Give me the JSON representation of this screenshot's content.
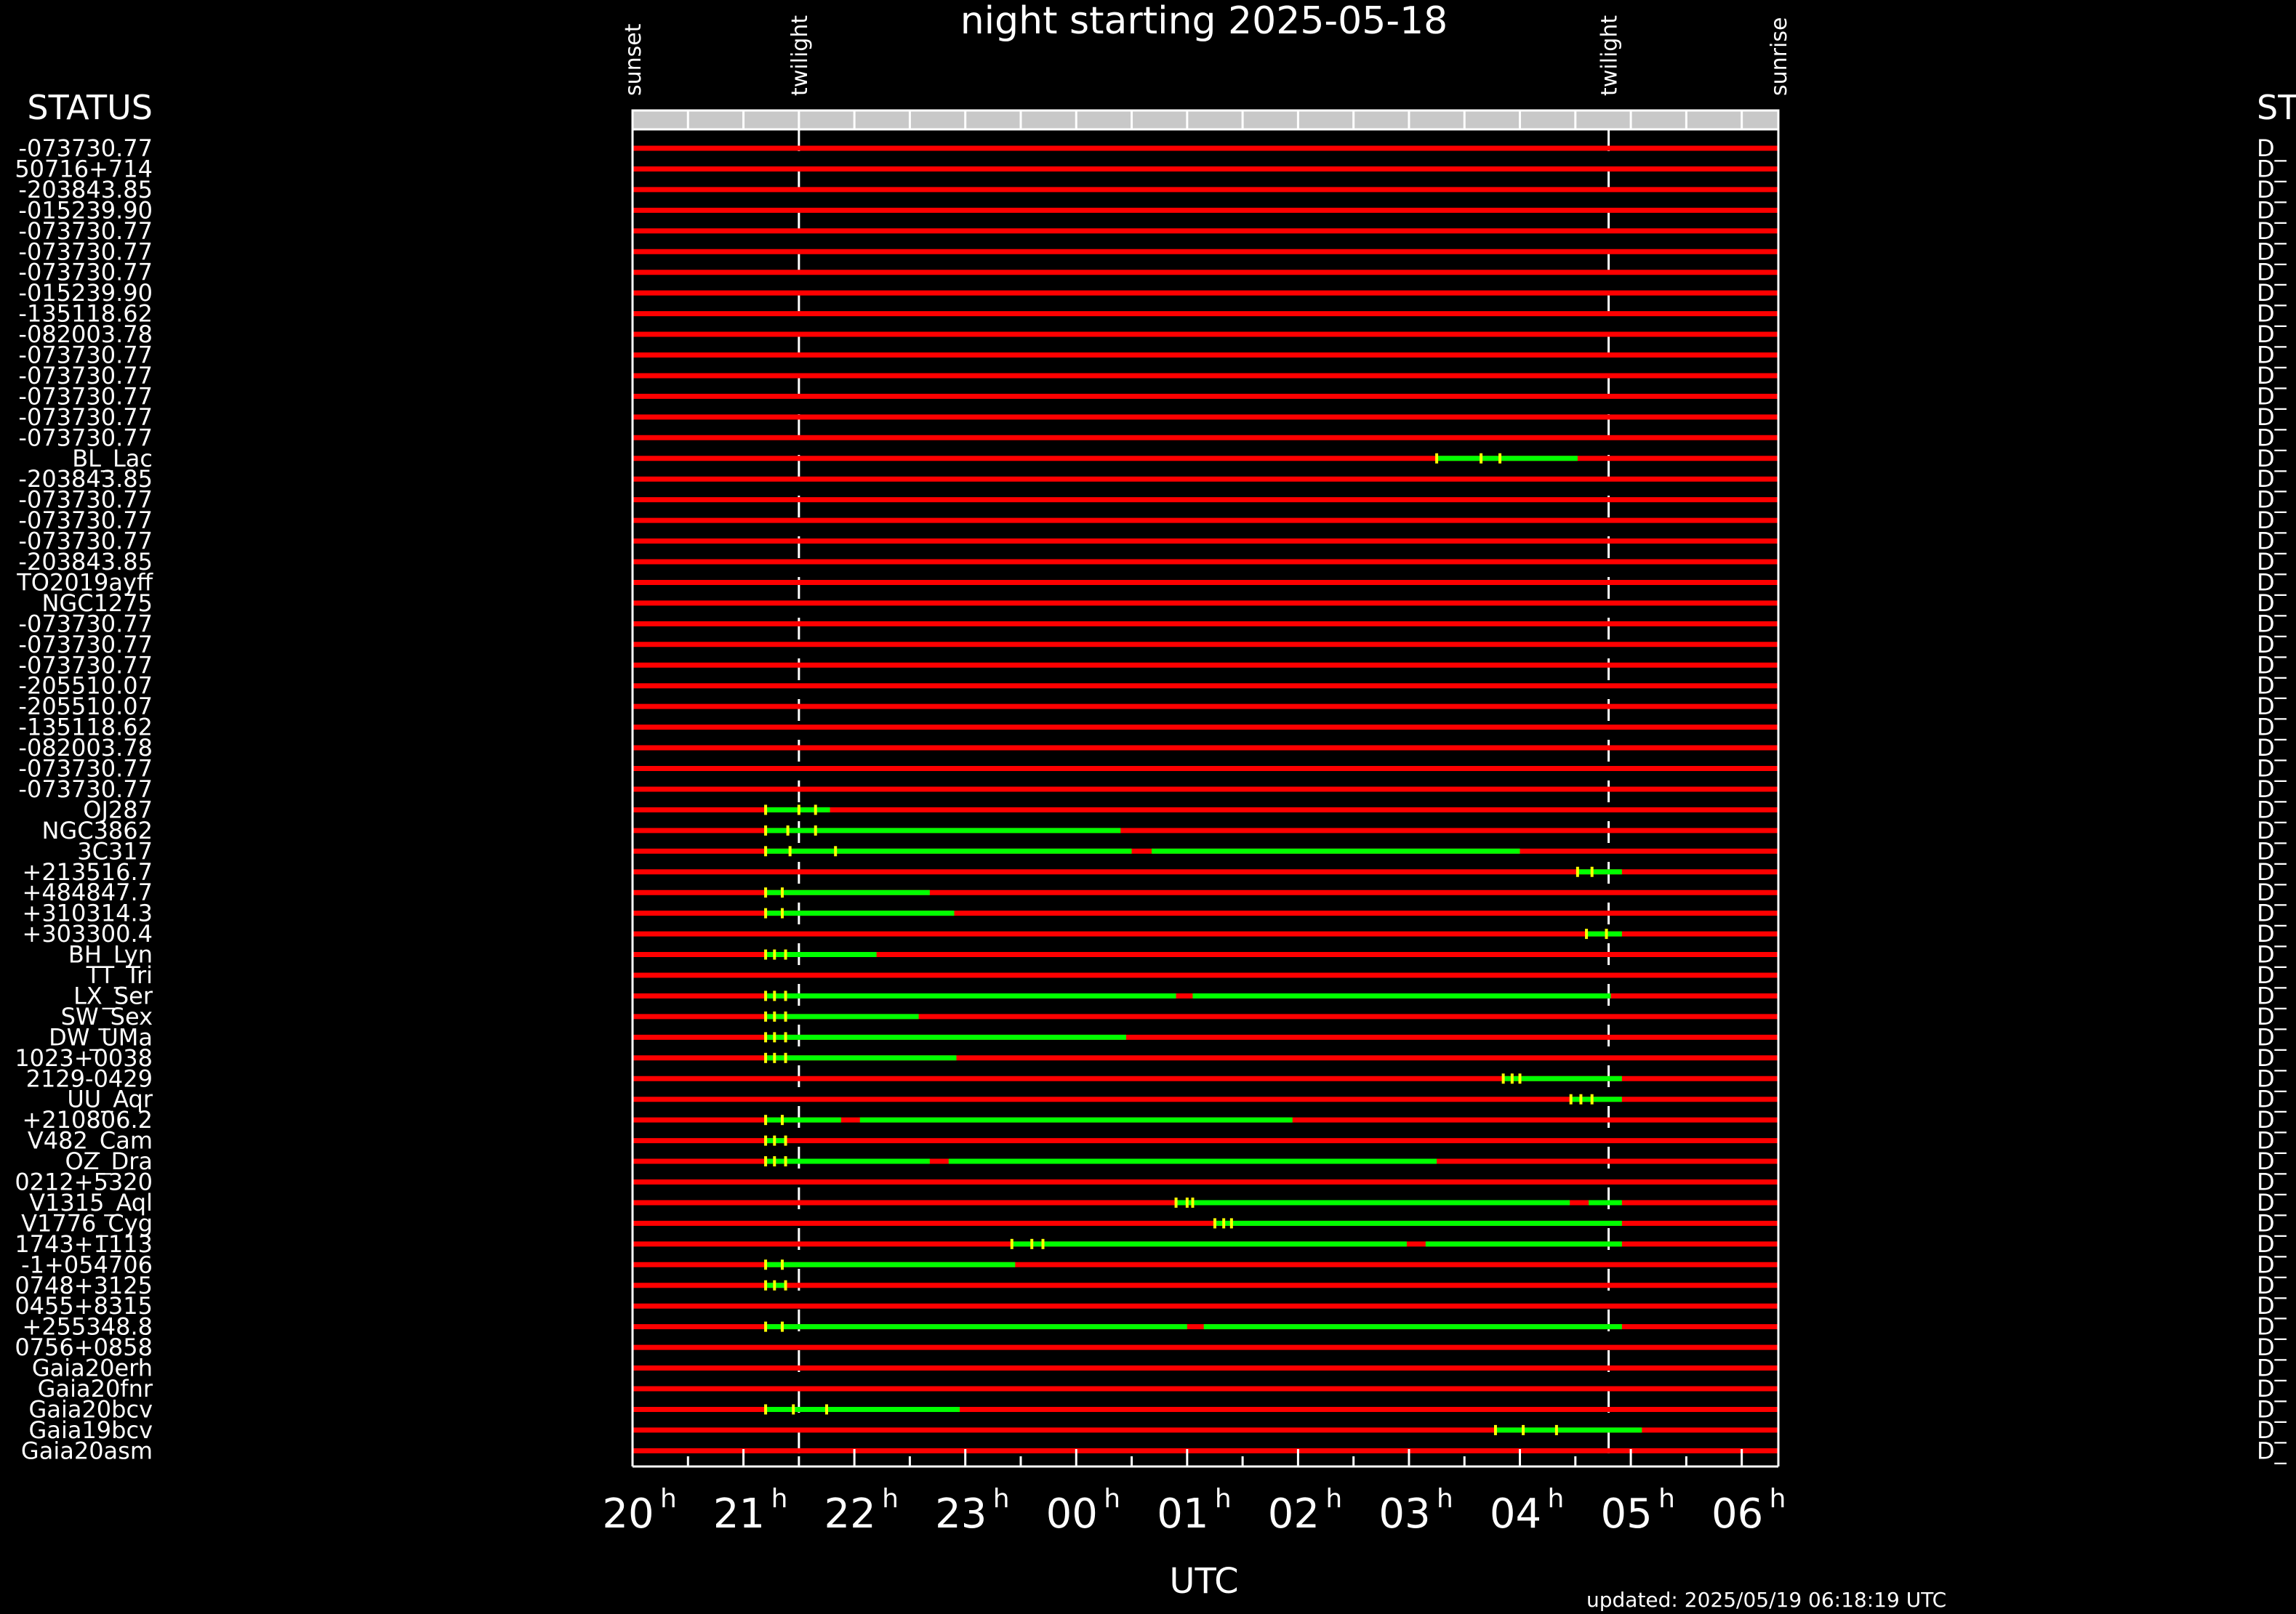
{
  "title": "night starting 2025-05-18",
  "status_header": "STATUS",
  "right_header": "ST",
  "xlabel": "UTC",
  "updated": "updated: 2025/05/19 06:18:19 UTC",
  "colors": {
    "background": "#000000",
    "unobservable": "#ff0000",
    "observable": "#00ff00",
    "marker": "#ffff00",
    "text": "#ffffff"
  },
  "chart_data": {
    "type": "timeline",
    "x_unit": "hours UTC (night starting 2025-05-18, values >24 are after midnight)",
    "xlim": [
      20.0,
      30.33
    ],
    "ticks": [
      {
        "label": "20",
        "value": 20
      },
      {
        "label": "21",
        "value": 21
      },
      {
        "label": "22",
        "value": 22
      },
      {
        "label": "23",
        "value": 23
      },
      {
        "label": "00",
        "value": 24
      },
      {
        "label": "01",
        "value": 25
      },
      {
        "label": "02",
        "value": 26
      },
      {
        "label": "03",
        "value": 27
      },
      {
        "label": "04",
        "value": 28
      },
      {
        "label": "05",
        "value": 29
      },
      {
        "label": "06",
        "value": 30
      }
    ],
    "tick_suffix": "h",
    "events": [
      {
        "label": "sunset",
        "value": 20.0,
        "dashed": false
      },
      {
        "label": "twilight",
        "value": 21.5,
        "dashed": true
      },
      {
        "label": "twilight",
        "value": 28.8,
        "dashed": true
      },
      {
        "label": "sunrise",
        "value": 30.33,
        "dashed": false
      }
    ],
    "rows": [
      {
        "name": "-073730.77",
        "status": "D_",
        "segs": []
      },
      {
        "name": "50716+714",
        "status": "D_",
        "segs": []
      },
      {
        "name": "-203843.85",
        "status": "D_",
        "segs": []
      },
      {
        "name": "-015239.90",
        "status": "D_",
        "segs": []
      },
      {
        "name": "-073730.77",
        "status": "D_",
        "segs": []
      },
      {
        "name": "-073730.77",
        "status": "D_",
        "segs": []
      },
      {
        "name": "-073730.77",
        "status": "D_",
        "segs": []
      },
      {
        "name": "-015239.90",
        "status": "D_",
        "segs": []
      },
      {
        "name": "-135118.62",
        "status": "D_",
        "segs": []
      },
      {
        "name": "-082003.78",
        "status": "D_",
        "segs": []
      },
      {
        "name": "-073730.77",
        "status": "D_",
        "segs": []
      },
      {
        "name": "-073730.77",
        "status": "D_",
        "segs": []
      },
      {
        "name": "-073730.77",
        "status": "D_",
        "segs": []
      },
      {
        "name": "-073730.77",
        "status": "D_",
        "segs": []
      },
      {
        "name": "-073730.77",
        "status": "D_",
        "segs": []
      },
      {
        "name": "BL_Lac",
        "status": "D_",
        "segs": [
          [
            27.25,
            28.52
          ]
        ],
        "marks": [
          27.25,
          27.65,
          27.82
        ]
      },
      {
        "name": "-203843.85",
        "status": "D_",
        "segs": []
      },
      {
        "name": "-073730.77",
        "status": "D_",
        "segs": []
      },
      {
        "name": "-073730.77",
        "status": "D_",
        "segs": []
      },
      {
        "name": "-073730.77",
        "status": "D_",
        "segs": []
      },
      {
        "name": "-203843.85",
        "status": "D_",
        "segs": []
      },
      {
        "name": "TO2019ayff",
        "status": "D_",
        "segs": []
      },
      {
        "name": "NGC1275",
        "status": "D_",
        "segs": []
      },
      {
        "name": "-073730.77",
        "status": "D_",
        "segs": []
      },
      {
        "name": "-073730.77",
        "status": "D_",
        "segs": []
      },
      {
        "name": "-073730.77",
        "status": "D_",
        "segs": []
      },
      {
        "name": "-205510.07",
        "status": "D_",
        "segs": []
      },
      {
        "name": "-205510.07",
        "status": "D_",
        "segs": []
      },
      {
        "name": "-135118.62",
        "status": "D_",
        "segs": []
      },
      {
        "name": "-082003.78",
        "status": "D_",
        "segs": []
      },
      {
        "name": "-073730.77",
        "status": "D_",
        "segs": []
      },
      {
        "name": "-073730.77",
        "status": "D_",
        "segs": []
      },
      {
        "name": "OJ287",
        "status": "D_",
        "segs": [
          [
            21.2,
            21.78
          ]
        ],
        "marks": [
          21.2,
          21.5,
          21.65
        ]
      },
      {
        "name": "NGC3862",
        "status": "D_",
        "segs": [
          [
            21.2,
            24.4
          ]
        ],
        "marks": [
          21.2,
          21.4,
          21.65
        ]
      },
      {
        "name": "3C317",
        "status": "D_",
        "segs": [
          [
            21.2,
            24.5
          ],
          [
            24.68,
            28.0
          ]
        ],
        "marks": [
          21.2,
          21.42,
          21.83
        ]
      },
      {
        "name": "+213516.7",
        "status": "D_",
        "segs": [
          [
            28.52,
            28.92
          ]
        ],
        "marks": [
          28.52,
          28.65
        ]
      },
      {
        "name": "+484847.7",
        "status": "D_",
        "segs": [
          [
            21.2,
            22.68
          ]
        ],
        "marks": [
          21.2,
          21.35
        ]
      },
      {
        "name": "+310314.3",
        "status": "D_",
        "segs": [
          [
            21.2,
            22.9
          ]
        ],
        "marks": [
          21.2,
          21.35
        ]
      },
      {
        "name": "+303300.4",
        "status": "D_",
        "segs": [
          [
            28.6,
            28.92
          ]
        ],
        "marks": [
          28.6,
          28.78
        ]
      },
      {
        "name": "BH_Lyn",
        "status": "D_",
        "segs": [
          [
            21.2,
            22.2
          ]
        ],
        "marks": [
          21.2,
          21.28,
          21.38
        ]
      },
      {
        "name": "TT_Tri",
        "status": "D_",
        "segs": []
      },
      {
        "name": "LX_Ser",
        "status": "D_",
        "segs": [
          [
            21.2,
            24.9
          ],
          [
            25.05,
            28.82
          ]
        ],
        "marks": [
          21.2,
          21.28,
          21.38
        ]
      },
      {
        "name": "SW_Sex",
        "status": "D_",
        "segs": [
          [
            21.2,
            22.58
          ]
        ],
        "marks": [
          21.2,
          21.28,
          21.38
        ]
      },
      {
        "name": "DW_UMa",
        "status": "D_",
        "segs": [
          [
            21.2,
            24.45
          ]
        ],
        "marks": [
          21.2,
          21.28,
          21.38
        ]
      },
      {
        "name": "1023+0038",
        "status": "D_",
        "segs": [
          [
            21.2,
            22.92
          ]
        ],
        "marks": [
          21.2,
          21.28,
          21.38
        ]
      },
      {
        "name": "2129-0429",
        "status": "D_",
        "segs": [
          [
            27.85,
            28.92
          ]
        ],
        "marks": [
          27.85,
          27.93,
          28.0
        ]
      },
      {
        "name": "UU_Aqr",
        "status": "D_",
        "segs": [
          [
            28.46,
            28.92
          ]
        ],
        "marks": [
          28.46,
          28.55,
          28.65
        ]
      },
      {
        "name": "+210806.2",
        "status": "D_",
        "segs": [
          [
            21.2,
            21.88
          ],
          [
            22.05,
            25.95
          ]
        ],
        "marks": [
          21.2,
          21.35
        ]
      },
      {
        "name": "V482_Cam",
        "status": "D_",
        "segs": [
          [
            21.2,
            21.38
          ]
        ],
        "marks": [
          21.2,
          21.28,
          21.38
        ]
      },
      {
        "name": "OZ_Dra",
        "status": "D_",
        "segs": [
          [
            21.2,
            22.68
          ],
          [
            22.85,
            27.25
          ]
        ],
        "marks": [
          21.2,
          21.28,
          21.38
        ]
      },
      {
        "name": "0212+5320",
        "status": "D_",
        "segs": []
      },
      {
        "name": "V1315_Aql",
        "status": "D_",
        "segs": [
          [
            24.9,
            28.45
          ],
          [
            28.62,
            28.92
          ]
        ],
        "marks": [
          24.9,
          25.0,
          25.05
        ]
      },
      {
        "name": "V1776_Cyg",
        "status": "D_",
        "segs": [
          [
            25.25,
            28.92
          ]
        ],
        "marks": [
          25.25,
          25.33,
          25.4
        ]
      },
      {
        "name": "1743+1113",
        "status": "D_",
        "segs": [
          [
            23.42,
            26.98
          ],
          [
            27.15,
            28.92
          ]
        ],
        "marks": [
          23.42,
          23.6,
          23.7
        ]
      },
      {
        "name": "-1+054706",
        "status": "D_",
        "segs": [
          [
            21.2,
            23.45
          ]
        ],
        "marks": [
          21.2,
          21.35
        ]
      },
      {
        "name": "0748+3125",
        "status": "D_",
        "segs": [
          [
            21.2,
            21.38
          ]
        ],
        "marks": [
          21.2,
          21.28,
          21.38
        ]
      },
      {
        "name": "0455+8315",
        "status": "D_",
        "segs": []
      },
      {
        "name": "+255348.8",
        "status": "D_",
        "segs": [
          [
            21.2,
            25.0
          ],
          [
            25.15,
            28.92
          ]
        ],
        "marks": [
          21.2,
          21.35
        ]
      },
      {
        "name": "0756+0858",
        "status": "D_",
        "segs": []
      },
      {
        "name": "Gaia20erh",
        "status": "D_",
        "segs": []
      },
      {
        "name": "Gaia20fnr",
        "status": "D_",
        "segs": []
      },
      {
        "name": "Gaia20bcv",
        "status": "D_",
        "segs": [
          [
            21.2,
            22.95
          ]
        ],
        "marks": [
          21.2,
          21.45,
          21.75
        ]
      },
      {
        "name": "Gaia19bcv",
        "status": "D_",
        "segs": [
          [
            27.78,
            29.1
          ]
        ],
        "marks": [
          27.78,
          28.03,
          28.33
        ]
      },
      {
        "name": "Gaia20asm",
        "status": "D_",
        "segs": []
      }
    ]
  }
}
